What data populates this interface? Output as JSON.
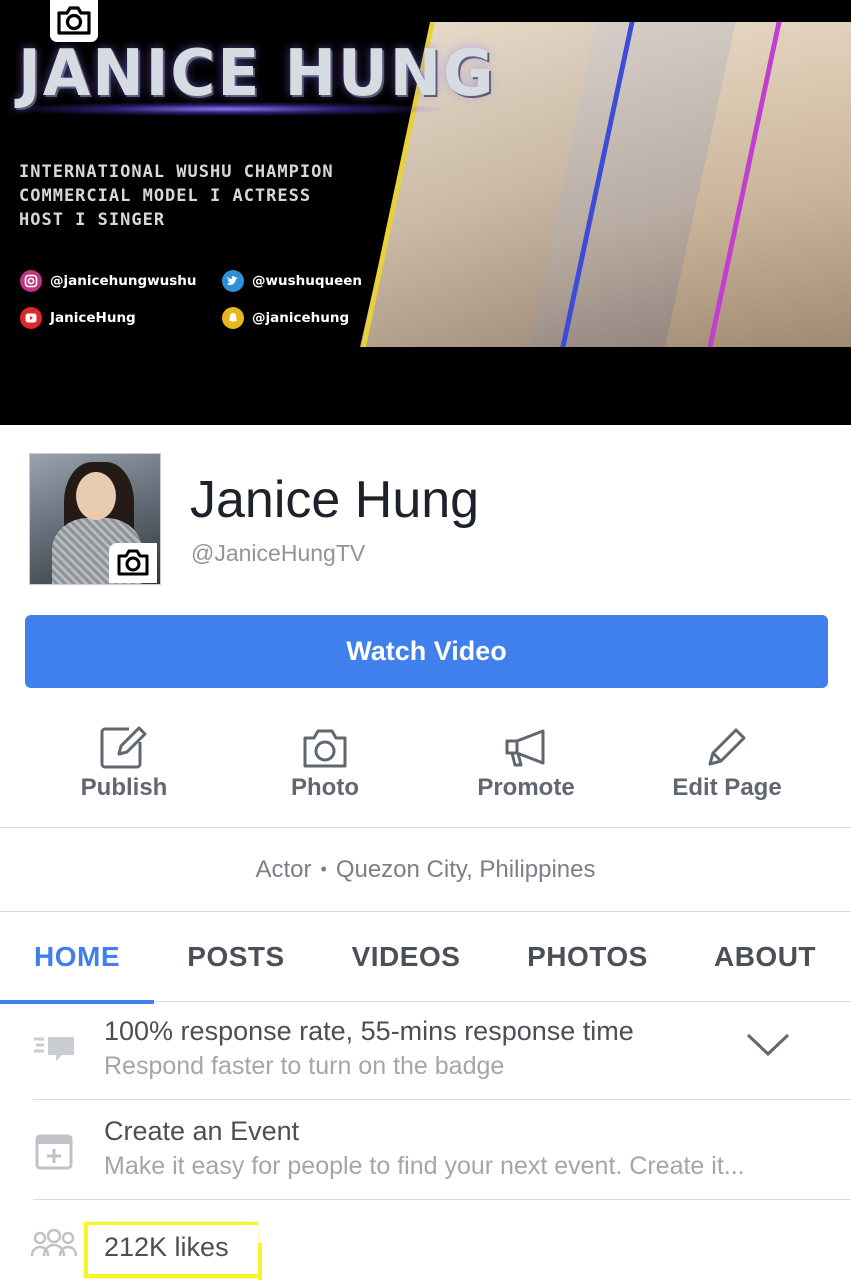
{
  "cover": {
    "title": "JANICE HUNG",
    "tagline": [
      "INTERNATIONAL WUSHU CHAMPION",
      "COMMERCIAL MODEL I ACTRESS",
      "HOST I SINGER"
    ],
    "social": {
      "instagram": "@janicehungwushu",
      "twitter": "@wushuqueen",
      "youtube": "JaniceHung",
      "snapchat": "@janicehung"
    },
    "stripe_colors": [
      "#e8d23a",
      "#3d4bd8",
      "#c03fd0"
    ]
  },
  "profile": {
    "name": "Janice Hung",
    "handle": "@JaniceHungTV"
  },
  "cta": {
    "label": "Watch Video",
    "color": "#4080ec"
  },
  "actions": [
    {
      "label": "Publish",
      "icon": "edit-square-icon"
    },
    {
      "label": "Photo",
      "icon": "camera-icon"
    },
    {
      "label": "Promote",
      "icon": "megaphone-icon"
    },
    {
      "label": "Edit Page",
      "icon": "pencil-icon"
    }
  ],
  "category": {
    "type": "Actor",
    "location": "Quezon City, Philippines"
  },
  "tabs": [
    {
      "label": "HOME",
      "active": true
    },
    {
      "label": "POSTS"
    },
    {
      "label": "VIDEOS"
    },
    {
      "label": "PHOTOS"
    },
    {
      "label": "ABOUT"
    }
  ],
  "rows": {
    "response": {
      "title": "100% response rate, 55-mins response time",
      "subtitle": "Respond faster to turn on the badge"
    },
    "event": {
      "title": "Create an Event",
      "subtitle": "Make it easy for people to find your next event. Create it..."
    },
    "likes": {
      "title": "212K likes"
    }
  }
}
